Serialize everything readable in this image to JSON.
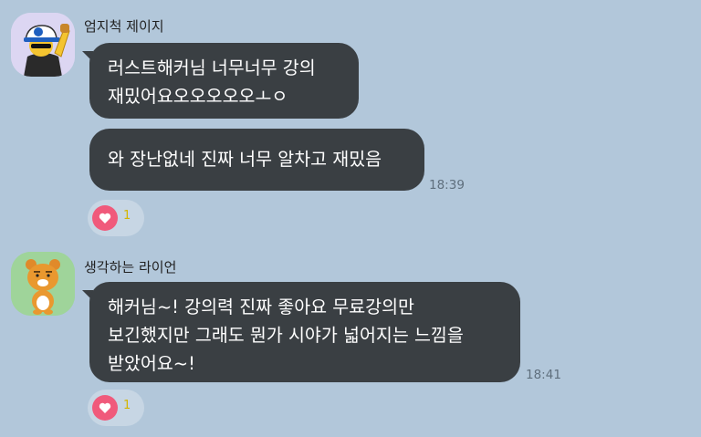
{
  "messages": [
    {
      "sender": "엄지척 제이지",
      "avatar": "jay-g-thumbs-up-icon",
      "bubbles": [
        {
          "text": "러스트해커님 너무너무 강의\n재밌어요오오오오오ㅗㅇ"
        },
        {
          "text": "와 장난없네 진짜 너무 알차고 재밌음"
        }
      ],
      "time": "18:39",
      "reaction": {
        "icon": "heart-icon",
        "count": "1"
      }
    },
    {
      "sender": "생각하는 라이언",
      "avatar": "ryan-lion-icon",
      "bubbles": [
        {
          "text": "해커님~! 강의력 진짜 좋아요 무료강의만\n보긴했지만 그래도 뭔가 시야가 넓어지는 느낌을\n받았어요~!"
        }
      ],
      "time": "18:41",
      "reaction": {
        "icon": "heart-icon",
        "count": "1"
      }
    }
  ],
  "colors": {
    "background": "#b2c7da",
    "bubble": "#3a3f43",
    "bubble_text": "#ffffff",
    "heart": "#f05a7b",
    "reaction_count": "#d4b500"
  }
}
